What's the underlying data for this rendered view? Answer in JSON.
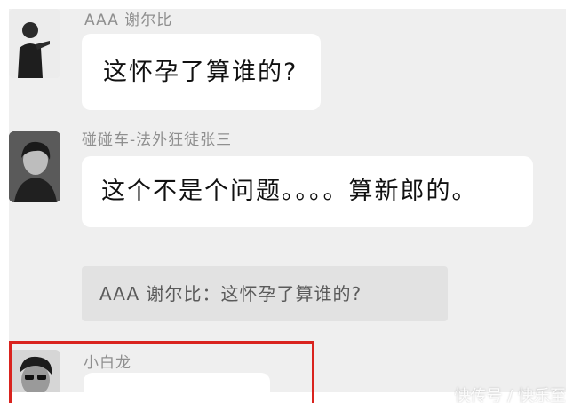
{
  "messages": [
    {
      "sender": "AAA 谢尔比",
      "text": "这怀孕了算谁的?"
    },
    {
      "sender": "碰碰车-法外狂徒张三",
      "text": "这个不是个问题。。。。算新郎的。",
      "quote": "AAA 谢尔比：这怀孕了算谁的?"
    },
    {
      "sender": "小白龙",
      "text": ""
    }
  ],
  "watermark": "快传号 / 快乐至",
  "colors": {
    "background": "#efefef",
    "bubble": "#ffffff",
    "quote_bg": "#e2e2e2",
    "highlight": "#d9231e"
  }
}
